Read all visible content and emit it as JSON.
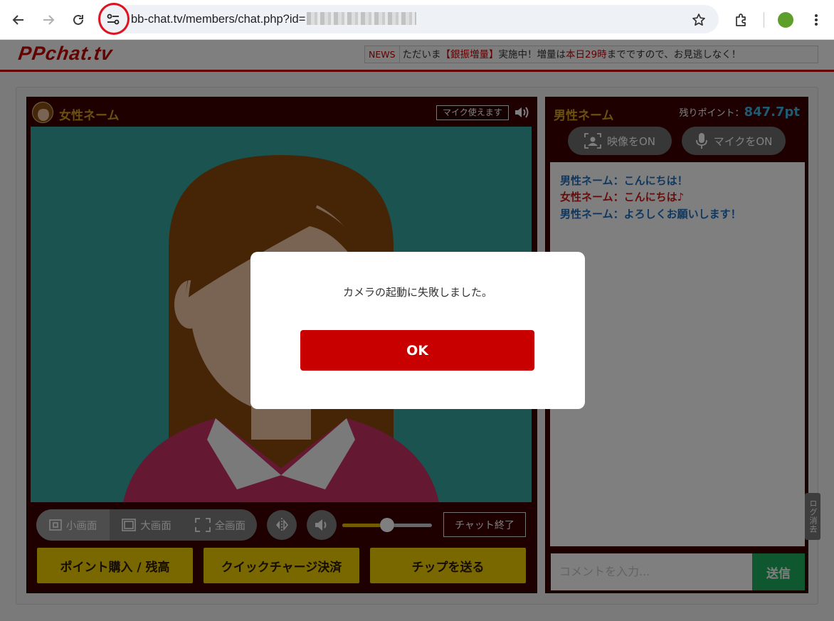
{
  "browser": {
    "url_visible": "bb-chat.tv/members/chat.php?id="
  },
  "site": {
    "logo": "PPchat.tv",
    "news_tag": "NEWS",
    "news_pre": "ただいま",
    "news_highlight": "【銀振増量】",
    "news_mid": "実施中！増量は",
    "news_highlight2": "本日29時",
    "news_post": "までですので、お見逃しなく！"
  },
  "left_panel": {
    "performer_name": "女性ネーム",
    "mic_badge": "マイク使えます",
    "view_buttons": [
      "小画面",
      "大画面",
      "全画面"
    ],
    "volume_level": 0.5,
    "end_chat": "チャット終了",
    "actions": [
      "ポイント購入 / 残高",
      "クイックチャージ決済",
      "チップを送る"
    ]
  },
  "right_panel": {
    "user_name": "男性ネーム",
    "points_label": "残りポイント：",
    "points_value": "847.7pt",
    "video_on": "映像をON",
    "mic_on": "マイクをON",
    "chat": [
      {
        "speaker": "男性ネーム",
        "text": "：こんにちは！",
        "color": "#1e6fbf"
      },
      {
        "speaker": "女性ネーム",
        "text": "：こんにちは♪",
        "color": "#d11a1a"
      },
      {
        "speaker": "男性ネーム",
        "text": "：よろしくお願いします！",
        "color": "#1e6fbf"
      }
    ],
    "log_clear": "ログ消去",
    "comment_placeholder": "コメントを入力...",
    "send": "送信"
  },
  "dialog": {
    "message": "カメラの起動に失敗しました。",
    "ok": "OK"
  },
  "colors": {
    "brand_red": "#c70000",
    "accent_yellow": "#f2cf00",
    "send_green": "#1fae5e"
  }
}
